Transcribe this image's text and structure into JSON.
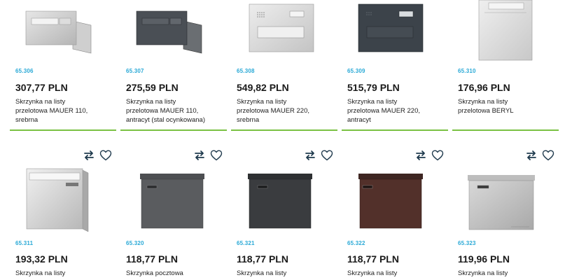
{
  "products_row1": [
    {
      "code": "65.306",
      "price": "307,77 PLN",
      "desc": [
        "Skrzynka na listy",
        "przelotowa MAUER 110,",
        "srebrna"
      ]
    },
    {
      "code": "65.307",
      "price": "275,59 PLN",
      "desc": [
        "Skrzynka na listy",
        "przelotowa MAUER 110,",
        "antracyt (stal ocynkowana)"
      ]
    },
    {
      "code": "65.308",
      "price": "549,82 PLN",
      "desc": [
        "Skrzynka na listy",
        "przelotowa MAUER 220,",
        "srebrna"
      ]
    },
    {
      "code": "65.309",
      "price": "515,79 PLN",
      "desc": [
        "Skrzynka na listy",
        "przelotowa MAUER 220,",
        "antracyt"
      ]
    },
    {
      "code": "65.310",
      "price": "176,96 PLN",
      "desc": [
        "Skrzynka na listy",
        "przelotowa BERYL",
        ""
      ]
    }
  ],
  "products_row2": [
    {
      "code": "65.311",
      "price": "193,32 PLN",
      "desc": [
        "Skrzynka na listy"
      ]
    },
    {
      "code": "65.320",
      "price": "118,77 PLN",
      "desc": [
        "Skrzynka pocztowa"
      ]
    },
    {
      "code": "65.321",
      "price": "118,77 PLN",
      "desc": [
        "Skrzynka na listy"
      ]
    },
    {
      "code": "65.322",
      "price": "118,77 PLN",
      "desc": [
        "Skrzynka na listy"
      ]
    },
    {
      "code": "65.323",
      "price": "119,96 PLN",
      "desc": [
        "Skrzynka na listy"
      ]
    }
  ],
  "icons": {
    "compare": "compare-arrows-icon",
    "favorite": "heart-icon"
  },
  "colors": {
    "accent_blue": "#29a9d6",
    "underline_green": "#7ac143",
    "icon_dark": "#1f3a4d"
  }
}
